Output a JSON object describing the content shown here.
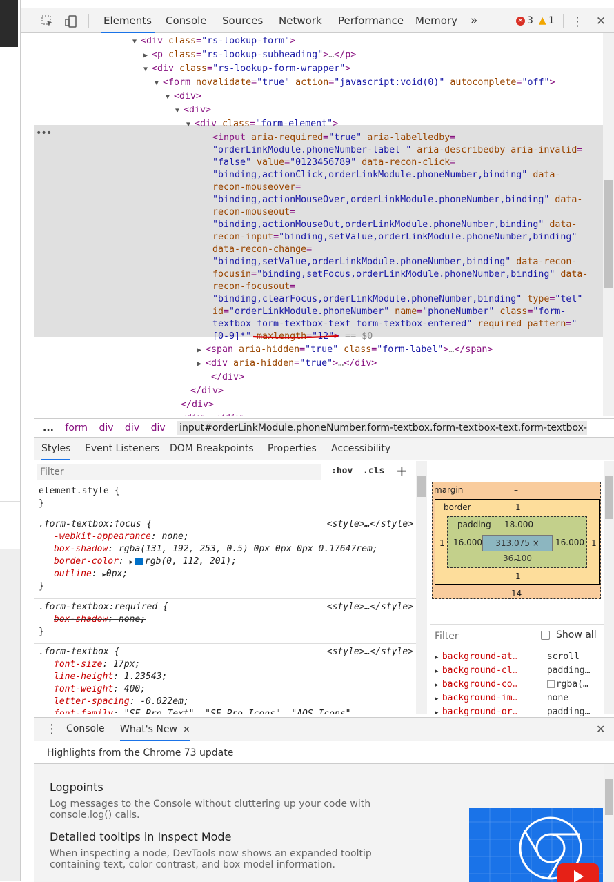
{
  "toolbar": {
    "tabs": [
      "Elements",
      "Console",
      "Sources",
      "Network",
      "Performance",
      "Memory"
    ],
    "more": "»",
    "errors": "3",
    "warnings": "1"
  },
  "dom_lines": [
    {
      "parts": [
        [
          "tag",
          "<div "
        ],
        [
          "an",
          "class"
        ],
        [
          "tag",
          "="
        ],
        [
          "av",
          "\"rs-lookup-form\""
        ],
        [
          "tag",
          ">"
        ]
      ]
    },
    {
      "parts": [
        [
          "tag",
          "<p "
        ],
        [
          "an",
          "class"
        ],
        [
          "tag",
          "="
        ],
        [
          "av",
          "\"rs-lookup-subheading\""
        ],
        [
          "tag",
          ">"
        ],
        [
          "gray",
          "…"
        ],
        [
          "tag",
          "</p>"
        ]
      ]
    },
    {
      "parts": [
        [
          "tag",
          "<div "
        ],
        [
          "an",
          "class"
        ],
        [
          "tag",
          "="
        ],
        [
          "av",
          "\"rs-lookup-form-wrapper\""
        ],
        [
          "tag",
          ">"
        ]
      ]
    },
    {
      "parts": [
        [
          "tag",
          "<form "
        ],
        [
          "an",
          "novalidate"
        ],
        [
          "tag",
          "="
        ],
        [
          "av",
          "\"true\""
        ],
        [
          "an",
          " action"
        ],
        [
          "tag",
          "="
        ],
        [
          "av",
          "\"javascript:void(0)\""
        ],
        [
          "an",
          " autocomplete"
        ],
        [
          "tag",
          "="
        ],
        [
          "av",
          "\"off\""
        ],
        [
          "tag",
          ">"
        ]
      ]
    },
    {
      "parts": [
        [
          "tag",
          "<div>"
        ]
      ]
    },
    {
      "parts": [
        [
          "tag",
          "<div>"
        ]
      ]
    },
    {
      "parts": [
        [
          "tag",
          "<div "
        ],
        [
          "an",
          "class"
        ],
        [
          "tag",
          "="
        ],
        [
          "av",
          "\"form-element\""
        ],
        [
          "tag",
          ">"
        ]
      ]
    },
    {
      "parts": [
        [
          "tag",
          "<input "
        ],
        [
          "an",
          "aria-required"
        ],
        [
          "tag",
          "="
        ],
        [
          "av",
          "\"true\""
        ],
        [
          "an",
          " aria-labelledby"
        ],
        [
          "tag",
          "="
        ]
      ]
    },
    {
      "parts": [
        [
          "av",
          "\"orderLinkModule.phoneNumber-label \""
        ],
        [
          "an",
          " aria-describedby aria-invalid"
        ],
        [
          "tag",
          "="
        ]
      ]
    },
    {
      "parts": [
        [
          "av",
          "\"false\""
        ],
        [
          "an",
          " value"
        ],
        [
          "tag",
          "="
        ],
        [
          "av",
          "\"0123456789\""
        ],
        [
          "an",
          " data-recon-click"
        ],
        [
          "tag",
          "="
        ]
      ]
    },
    {
      "parts": [
        [
          "av",
          "\"binding,actionClick,orderLinkModule.phoneNumber,binding\""
        ],
        [
          "an",
          " data-"
        ]
      ]
    },
    {
      "parts": [
        [
          "an",
          "recon-mouseover"
        ],
        [
          "tag",
          "="
        ]
      ]
    },
    {
      "parts": [
        [
          "av",
          "\"binding,actionMouseOver,orderLinkModule.phoneNumber,binding\""
        ],
        [
          "an",
          " data-"
        ]
      ]
    },
    {
      "parts": [
        [
          "an",
          "recon-mouseout"
        ],
        [
          "tag",
          "="
        ]
      ]
    },
    {
      "parts": [
        [
          "av",
          "\"binding,actionMouseOut,orderLinkModule.phoneNumber,binding\""
        ],
        [
          "an",
          " data-"
        ]
      ]
    },
    {
      "parts": [
        [
          "an",
          "recon-input"
        ],
        [
          "tag",
          "="
        ],
        [
          "av",
          "\"binding,setValue,orderLinkModule.phoneNumber,binding\""
        ]
      ]
    },
    {
      "parts": [
        [
          "an",
          "data-recon-change"
        ],
        [
          "tag",
          "="
        ]
      ]
    },
    {
      "parts": [
        [
          "av",
          "\"binding,setValue,orderLinkModule.phoneNumber,binding\""
        ],
        [
          "an",
          " data-recon-"
        ]
      ]
    },
    {
      "parts": [
        [
          "an",
          "focusin"
        ],
        [
          "tag",
          "="
        ],
        [
          "av",
          "\"binding,setFocus,orderLinkModule.phoneNumber,binding\""
        ],
        [
          "an",
          " data-"
        ]
      ]
    },
    {
      "parts": [
        [
          "an",
          "recon-focusout"
        ],
        [
          "tag",
          "="
        ]
      ]
    },
    {
      "parts": [
        [
          "av",
          "\"binding,clearFocus,orderLinkModule.phoneNumber,binding\""
        ],
        [
          "an",
          " type"
        ],
        [
          "tag",
          "="
        ],
        [
          "av",
          "\"tel\""
        ]
      ]
    },
    {
      "parts": [
        [
          "an",
          "id"
        ],
        [
          "tag",
          "="
        ],
        [
          "av",
          "\"orderLinkModule.phoneNumber\""
        ],
        [
          "an",
          " name"
        ],
        [
          "tag",
          "="
        ],
        [
          "av",
          "\"phoneNumber\""
        ],
        [
          "an",
          " class"
        ],
        [
          "tag",
          "="
        ],
        [
          "av",
          "\"form-"
        ]
      ]
    },
    {
      "parts": [
        [
          "av",
          "textbox form-textbox-text form-textbox-entered\""
        ],
        [
          "an",
          " required pattern"
        ],
        [
          "tag",
          "="
        ],
        [
          "av",
          "\""
        ]
      ]
    },
    {
      "parts": [
        [
          "av",
          "[0-9]*\""
        ],
        [
          "an",
          " maxlength"
        ],
        [
          "tag",
          "="
        ],
        [
          "av",
          "\"12\""
        ],
        [
          "tag",
          ">"
        ],
        [
          "gray",
          " == $0"
        ]
      ]
    },
    {
      "parts": [
        [
          "tag",
          "<span "
        ],
        [
          "an",
          "aria-hidden"
        ],
        [
          "tag",
          "="
        ],
        [
          "av",
          "\"true\""
        ],
        [
          "an",
          " class"
        ],
        [
          "tag",
          "="
        ],
        [
          "av",
          "\"form-label\""
        ],
        [
          "tag",
          ">"
        ],
        [
          "gray",
          "…"
        ],
        [
          "tag",
          "</span>"
        ]
      ]
    },
    {
      "parts": [
        [
          "tag",
          "<div "
        ],
        [
          "an",
          "aria-hidden"
        ],
        [
          "tag",
          "="
        ],
        [
          "av",
          "\"true\""
        ],
        [
          "tag",
          ">"
        ],
        [
          "gray",
          "…"
        ],
        [
          "tag",
          "</div>"
        ]
      ]
    },
    {
      "parts": [
        [
          "tag",
          "</div>"
        ]
      ]
    },
    {
      "parts": [
        [
          "tag",
          "</div>"
        ]
      ]
    },
    {
      "parts": [
        [
          "tag",
          "</div>"
        ]
      ]
    },
    {
      "parts": [
        [
          "tag",
          "<div>"
        ],
        [
          "gray",
          "…"
        ],
        [
          "tag",
          "</div>"
        ]
      ]
    }
  ],
  "breadcrumb": [
    "...",
    "form",
    "div",
    "div",
    "div",
    "input#orderLinkModule.phoneNumber.form-textbox.form-textbox-text.form-textbox-entered"
  ],
  "subtabs": [
    "Styles",
    "Event Listeners",
    "DOM Breakpoints",
    "Properties",
    "Accessibility"
  ],
  "styles": {
    "filter_placeholder": "Filter",
    "hov": ":hov",
    "cls": ".cls",
    "add": "+",
    "rules": [
      {
        "selector": "element.style {",
        "source": "",
        "props": [],
        "close": "}"
      },
      {
        "selector": ".form-textbox:focus {",
        "source": "<style>…</style>",
        "props": [
          [
            "-webkit-appearance",
            "none;",
            ""
          ],
          [
            "box-shadow",
            "rgba(131, 192, 253, 0.5) 0px 0px 0px 0.17647rem;",
            ""
          ],
          [
            "border-color",
            "rgb(0, 112, 201);",
            "#0070c9"
          ],
          [
            "outline",
            "0px;",
            ""
          ]
        ],
        "close": "}"
      },
      {
        "selector": ".form-textbox:required {",
        "source": "<style>…</style>",
        "props": [
          [
            "box-shadow",
            "none;",
            "strike"
          ]
        ],
        "close": "}"
      },
      {
        "selector": ".form-textbox {",
        "source": "<style>…</style>",
        "props": [
          [
            "font-size",
            "17px;",
            ""
          ],
          [
            "line-height",
            "1.23543;",
            ""
          ],
          [
            "font-weight",
            "400;",
            ""
          ],
          [
            "letter-spacing",
            "-0.022em;",
            ""
          ],
          [
            "font-family",
            "\"SF Pro Text\", \"SF Pro Icons\", \"AOS Icons\",",
            ""
          ]
        ],
        "close": ""
      }
    ]
  },
  "boxmodel": {
    "margin_label": "margin",
    "margin_top": "–",
    "margin_bottom": "14",
    "border_label": "border",
    "border_top": "1",
    "border_left": "1",
    "border_right": "1",
    "border_bottom": "1",
    "padding_label": "padding",
    "padding_top": "18.000",
    "padding_left": "16.000",
    "padding_right": "16.000",
    "padding_bottom": "–",
    "content": "313.075 × 36.100"
  },
  "computed": {
    "filter_placeholder": "Filter",
    "show_all": "Show all",
    "props": [
      [
        "background-at…",
        "scroll"
      ],
      [
        "background-cl…",
        "padding…"
      ],
      [
        "background-co…",
        "rgba(…"
      ],
      [
        "background-im…",
        "none"
      ],
      [
        "background-or…",
        "padding…"
      ]
    ]
  },
  "drawer": {
    "tabs": [
      "Console",
      "What's New"
    ],
    "header": "Highlights from the Chrome 73 update",
    "items": [
      {
        "title": "Logpoints",
        "desc": "Log messages to the Console without cluttering up your code with console.log() calls."
      },
      {
        "title": "Detailed tooltips in Inspect Mode",
        "desc": "When inspecting a node, DevTools now shows an expanded tooltip containing text, color contrast, and box model information."
      }
    ]
  },
  "colors": {
    "accent": "#1a73e8",
    "error": "#d93025",
    "warning": "#f2a600",
    "underline": "#d50000"
  }
}
